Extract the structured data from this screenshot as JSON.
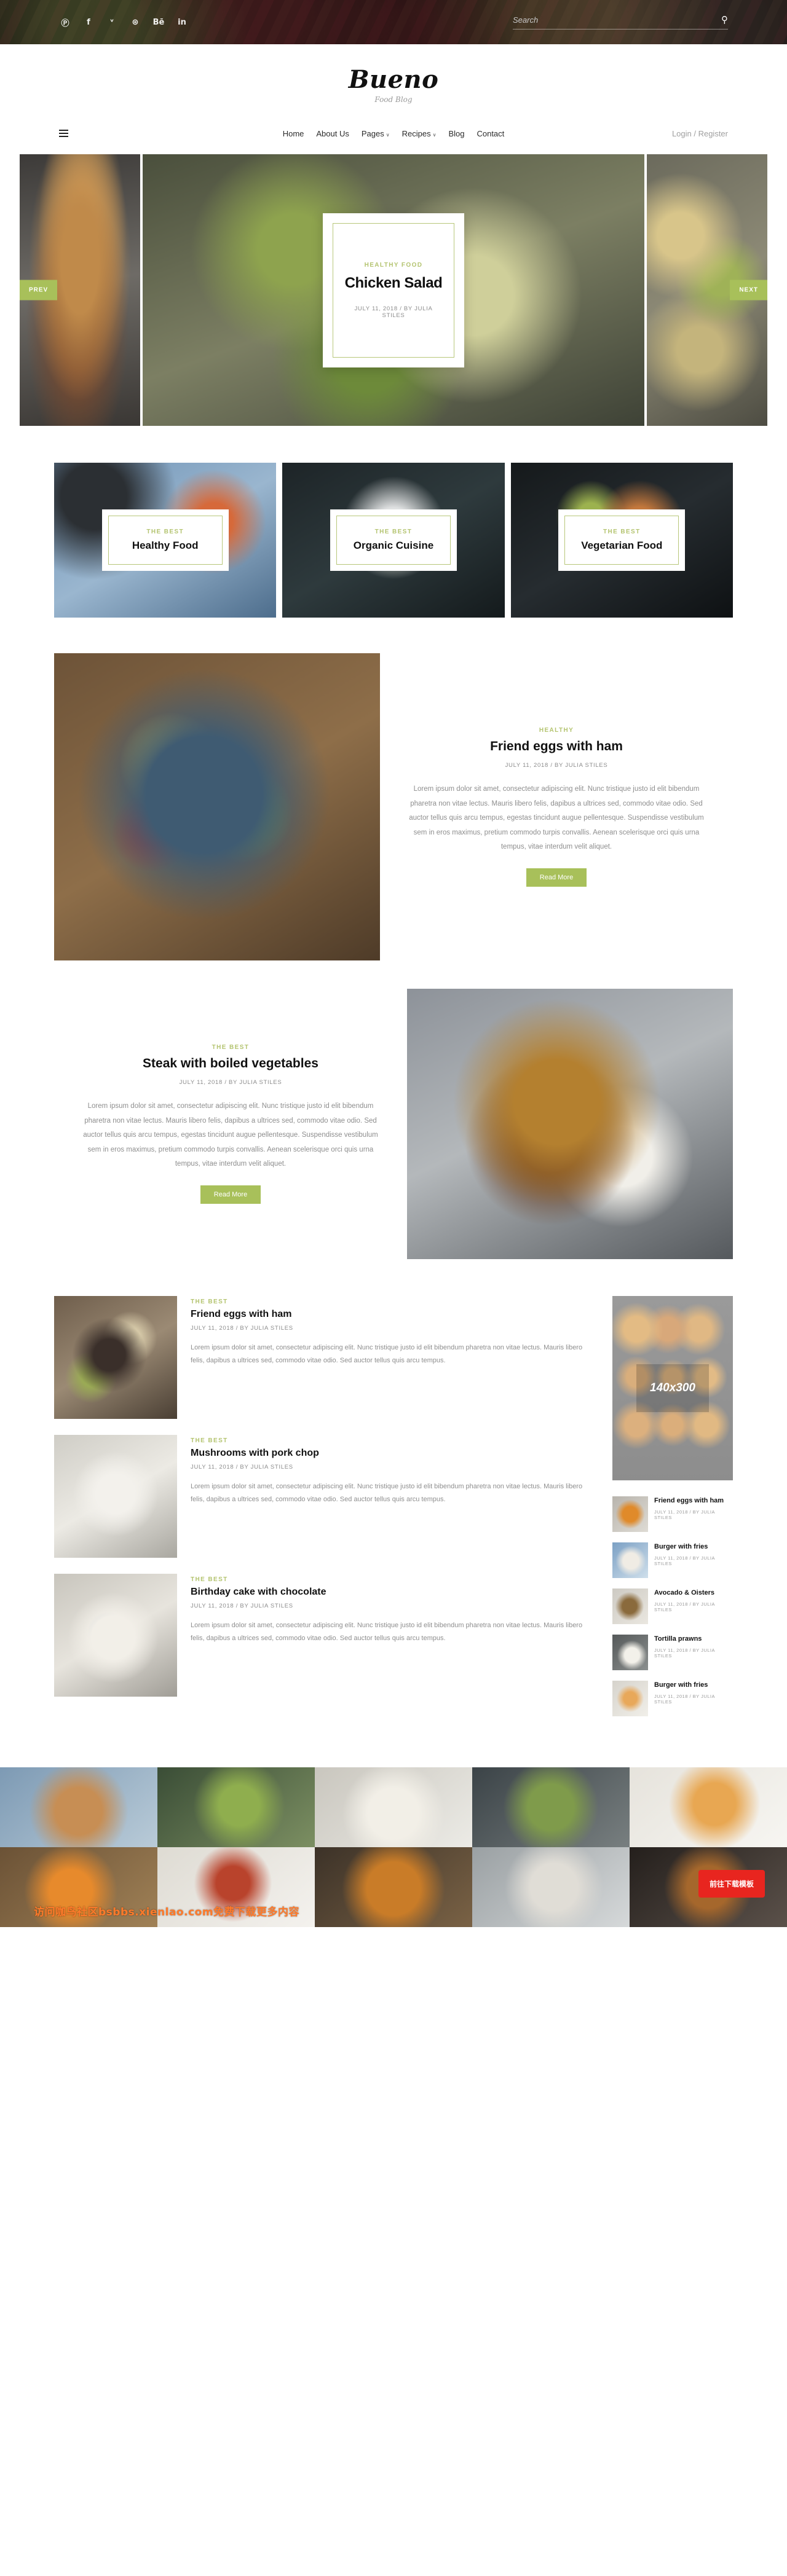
{
  "topbar": {
    "social": [
      {
        "name": "pinterest-icon",
        "glyph": "Ⓟ"
      },
      {
        "name": "facebook-icon",
        "glyph": "f"
      },
      {
        "name": "twitter-icon",
        "glyph": "ᵛ"
      },
      {
        "name": "dribbble-icon",
        "glyph": "⊛"
      },
      {
        "name": "behance-icon",
        "glyph": "Bē"
      },
      {
        "name": "linkedin-icon",
        "glyph": "in"
      }
    ],
    "search_placeholder": "Search",
    "search_value": "",
    "search_icon": "⚲"
  },
  "logo": {
    "name": "Bueno",
    "tagline": "Food Blog"
  },
  "nav": {
    "menu_icon": "hamburger-icon",
    "links": [
      {
        "label": "Home",
        "caret": ""
      },
      {
        "label": "About Us",
        "caret": ""
      },
      {
        "label": "Pages",
        "caret": "∨"
      },
      {
        "label": "Recipes",
        "caret": "∨"
      },
      {
        "label": "Blog",
        "caret": ""
      },
      {
        "label": "Contact",
        "caret": ""
      }
    ],
    "login": "Login / Register"
  },
  "hero": {
    "prev_label": "PREV",
    "next_label": "NEXT",
    "slide": {
      "category": "HEALTHY FOOD",
      "title": "Chicken Salad",
      "date": "JULY 11, 2018",
      "separator": "/",
      "author": "BY JULIA STILES"
    }
  },
  "categories": [
    {
      "eyebrow": "THE BEST",
      "title": "Healthy Food"
    },
    {
      "eyebrow": "THE BEST",
      "title": "Organic Cuisine"
    },
    {
      "eyebrow": "THE BEST",
      "title": "Vegetarian Food"
    }
  ],
  "features": [
    {
      "eyebrow": "HEALTHY",
      "title": "Friend eggs with ham",
      "date": "JULY 11, 2018",
      "separator": "/",
      "author": "BY JULIA STILES",
      "text": "Lorem ipsum dolor sit amet, consectetur adipiscing elit. Nunc tristique justo id elit bibendum pharetra non vitae lectus. Mauris libero felis, dapibus a ultrices sed, commodo vitae odio. Sed auctor tellus quis arcu tempus, egestas tincidunt augue pellentesque. Suspendisse vestibulum sem in eros maximus, pretium commodo turpis convallis. Aenean scelerisque orci quis urna tempus, vitae interdum velit aliquet.",
      "button": "Read More"
    },
    {
      "eyebrow": "THE BEST",
      "title": "Steak with boiled vegetables",
      "date": "JULY 11, 2018",
      "separator": "/",
      "author": "BY JULIA STILES",
      "text": "Lorem ipsum dolor sit amet, consectetur adipiscing elit. Nunc tristique justo id elit bibendum pharetra non vitae lectus. Mauris libero felis, dapibus a ultrices sed, commodo vitae odio. Sed auctor tellus quis arcu tempus, egestas tincidunt augue pellentesque. Suspendisse vestibulum sem in eros maximus, pretium commodo turpis convallis. Aenean scelerisque orci quis urna tempus, vitae interdum velit aliquet.",
      "button": "Read More"
    }
  ],
  "posts": [
    {
      "eyebrow": "THE BEST",
      "title": "Friend eggs with ham",
      "date": "JULY 11, 2018",
      "separator": "/",
      "author": "BY JULIA STILES",
      "text": "Lorem ipsum dolor sit amet, consectetur adipiscing elit. Nunc tristique justo id elit bibendum pharetra non vitae lectus. Mauris libero felis, dapibus a ultrices sed, commodo vitae odio. Sed auctor tellus quis arcu tempus."
    },
    {
      "eyebrow": "THE BEST",
      "title": "Mushrooms with pork chop",
      "date": "JULY 11, 2018",
      "separator": "/",
      "author": "BY JULIA STILES",
      "text": "Lorem ipsum dolor sit amet, consectetur adipiscing elit. Nunc tristique justo id elit bibendum pharetra non vitae lectus. Mauris libero felis, dapibus a ultrices sed, commodo vitae odio. Sed auctor tellus quis arcu tempus."
    },
    {
      "eyebrow": "THE BEST",
      "title": "Birthday cake with chocolate",
      "date": "JULY 11, 2018",
      "separator": "/",
      "author": "BY JULIA STILES",
      "text": "Lorem ipsum dolor sit amet, consectetur adipiscing elit. Nunc tristique justo id elit bibendum pharetra non vitae lectus. Mauris libero felis, dapibus a ultrices sed, commodo vitae odio. Sed auctor tellus quis arcu tempus."
    }
  ],
  "sidebar": {
    "ad_label": "140x300",
    "items": [
      {
        "title": "Friend eggs with ham",
        "meta": "JULY 11, 2018  /  BY JULIA STILES"
      },
      {
        "title": "Burger with fries",
        "meta": "JULY 11, 2018  /  BY JULIA STILES"
      },
      {
        "title": "Avocado & Oisters",
        "meta": "JULY 11, 2018  /  BY JULIA STILES"
      },
      {
        "title": "Tortilla prawns",
        "meta": "JULY 11, 2018  /  BY JULIA STILES"
      },
      {
        "title": "Burger with fries",
        "meta": "JULY 11, 2018  /  BY JULIA STILES"
      }
    ]
  },
  "overlay": {
    "watermark": "访问咖鸟社区bsbbs.xienlao.com免费下载更多内容",
    "download_button": "前往下载模板"
  },
  "colors": {
    "accent_green": "#a8c05a",
    "eyebrow_green": "#b4c470",
    "download_red": "#e8251f"
  }
}
